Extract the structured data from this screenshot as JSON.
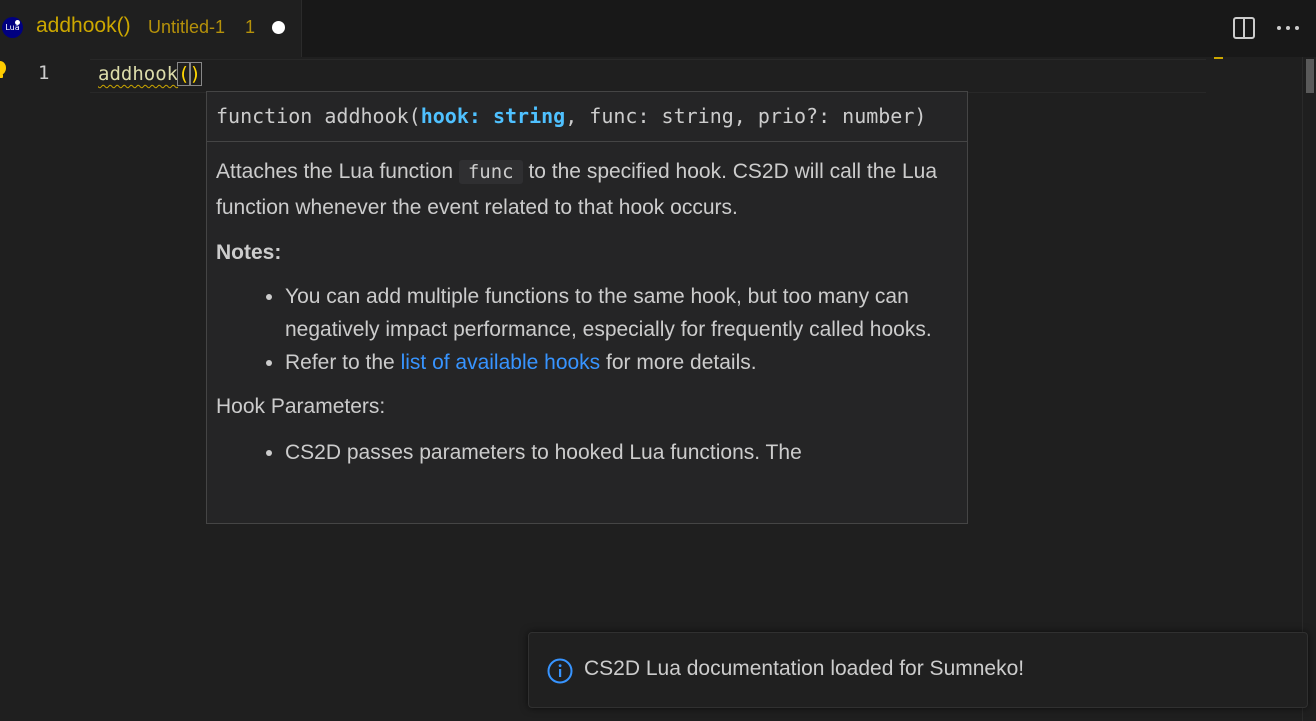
{
  "tab": {
    "icon_label": "Lua",
    "title": "addhook()",
    "description": "Untitled-1",
    "problem_count": "1"
  },
  "editor": {
    "line_number": "1",
    "code_function": "addhook",
    "code_open_paren": "(",
    "code_close_paren": ")"
  },
  "hover": {
    "signature": {
      "prefix": "function addhook(",
      "active_param": "hook: string",
      "rest": ", func: string, prio?: number)"
    },
    "description": {
      "before": "Attaches the Lua function ",
      "code": "func",
      "after": " to the specified hook. CS2D will call the Lua function whenever the event related to that hook occurs."
    },
    "notes_heading": "Notes:",
    "notes": {
      "item1": "You can add multiple functions to the same hook, but too many can negatively impact performance, especially for frequently called hooks.",
      "item2_before": "Refer to the ",
      "item2_link": "list of available hooks",
      "item2_after": " for more details."
    },
    "hook_params_heading": "Hook Parameters:",
    "hook_params_item1": "CS2D passes parameters to hooked Lua functions. The"
  },
  "notification": {
    "message": "CS2D Lua documentation loaded for Sumneko!"
  },
  "colors": {
    "warning": "#cca700",
    "link": "#3794ff",
    "param_highlight": "#4fc1ff",
    "info": "#3794ff"
  },
  "icons": {
    "tab_file": "lua-file-icon",
    "split": "split-editor-icon",
    "more": "more-actions-icon",
    "lightbulb": "lightbulb-icon",
    "info": "info-icon"
  }
}
